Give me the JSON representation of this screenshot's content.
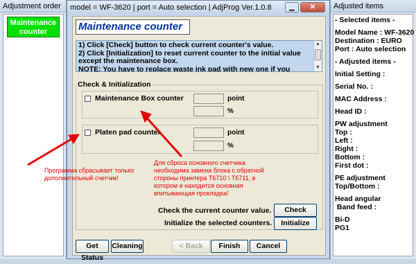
{
  "left_window": {
    "title": "Adjustment order",
    "active_item": "Maintenance\ncounter"
  },
  "main_window": {
    "title": "model = WF-3620 | port = Auto selection | AdjProg Ver.1.0.8",
    "close_icon": "close-icon",
    "minimize_icon": "minimize-icon",
    "heading": "Maintenance counter",
    "description": [
      "1) Click [Check] button to check current counter's value.",
      "2) Click [Initialization] to reset current counter to the initial value except the maintenance box.",
      "NOTE: You have to replace waste ink pad with new one if you initialize the"
    ],
    "group_label": "Check & Initialization",
    "counters": [
      {
        "label": "Maintenance Box counter",
        "unit1": "point",
        "unit2": "%"
      },
      {
        "label": "Platen pad counter",
        "unit1": "point",
        "unit2": "%"
      }
    ],
    "check_label": "Check the current counter value. -->",
    "check_button": "Check",
    "init_label": "Initialize the selected counters. -->",
    "init_button": "Initialize",
    "footer_buttons": {
      "get_status": "Get Status",
      "cleaning": "Cleaning",
      "back": "< Back",
      "finish": "Finish",
      "cancel": "Cancel"
    }
  },
  "annotations": {
    "left_note": "Программа сбрасывает только\nдополнительный счетчик!",
    "center_note": "Для сброса основного счетчика\nнеобходима замена блока с обратной\nстороны принтера T6710 \\ T6711, в\nкотором и находится основная\nвпитывающая прокладка!",
    "arrow_color": "#e00000"
  },
  "right_window": {
    "title": "Adjusted items",
    "lines": [
      "- Selected items -",
      "",
      "Model Name : WF-3620",
      "Destination : EURO",
      "Port : Auto selection",
      "",
      "- Adjusted items -",
      "",
      "Initial Setting :",
      "",
      "Serial No. :",
      "",
      "MAC Address :",
      "",
      "Head ID :",
      "",
      "PW adjustment",
      "Top :",
      "Left :",
      "Right :",
      "Bottom :",
      "First dot :",
      "",
      "PE adjustment",
      "Top/Bottom :",
      "",
      "Head angular",
      " Band feed :",
      "",
      "Bi-D",
      "PG1"
    ]
  }
}
